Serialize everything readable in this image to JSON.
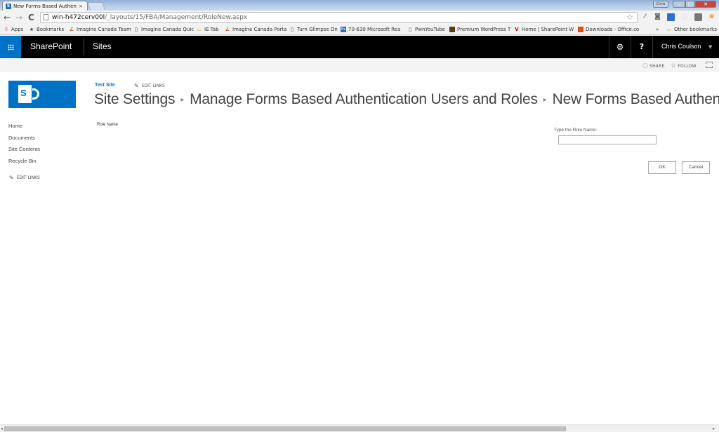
{
  "browser": {
    "tab": {
      "title": "New Forms Based Authen",
      "favicon": "sharepoint-icon",
      "close": "×"
    },
    "window": {
      "user_badge": "Chris",
      "minimize": "–",
      "maximize": "□",
      "close": "✕"
    },
    "toolbar": {
      "back": "←",
      "forward": "→",
      "reload": "C",
      "url_host": "win-h472cerv00l",
      "url_path": "/_layouts/15/FBA/Management/RoleNew.aspx",
      "star": "☆",
      "extensions": [
        "eyedropper-icon",
        "camera-icon",
        "window-icon",
        "refresh-ext-icon",
        "square-ext-icon",
        "menu-icon"
      ],
      "menu": "≡"
    },
    "bookmarks": [
      {
        "label": "Apps",
        "icon": "apps-grid-icon"
      },
      {
        "label": "Bookmarks",
        "icon": "star-icon"
      },
      {
        "label": "Imagine Canada Team",
        "icon": "imagine-canada-icon"
      },
      {
        "label": "Imagine Canada Quic",
        "icon": "page-icon"
      },
      {
        "label": "IE Tab",
        "icon": "folder-icon"
      },
      {
        "label": "Imagine Canada Porta",
        "icon": "imagine-canada-icon"
      },
      {
        "label": "Turn Glimpse On",
        "icon": "page-icon"
      },
      {
        "label": "70-630 Microsoft Rea",
        "icon": "ms-exam-icon"
      },
      {
        "label": "PwnYouTube",
        "icon": "page-icon"
      },
      {
        "label": "Premium WordPress T",
        "icon": "wordpress-theme-icon"
      },
      {
        "label": "Home | SharePoint W",
        "icon": "sharepoint-w-icon"
      },
      {
        "label": "Downloads - Office.co",
        "icon": "office-icon"
      }
    ],
    "bookmarks_overflow": "»",
    "other_bookmarks": "Other bookmarks"
  },
  "suitebar": {
    "brand": "SharePoint",
    "sites": "Sites",
    "settings_icon": "⚙",
    "help": "?",
    "user_name": "Chris Coulson",
    "user_caret": "▼"
  },
  "ribbon": {
    "share": "SHARE",
    "follow": "FOLLOW"
  },
  "header": {
    "site_title": "Test Site",
    "edit_links": "EDIT LINKS",
    "breadcrumb": [
      "Site Settings",
      "Manage Forms Based Authentication Users and Roles",
      "New Forms Based Authentication Role"
    ],
    "breadcrumb_sep": "▸"
  },
  "left_nav": {
    "items": [
      "Home",
      "Documents",
      "Site Contents",
      "Recycle Bin"
    ],
    "edit_links": "EDIT LINKS"
  },
  "form": {
    "section_label": "Role Name",
    "field_label": "Type the Role Name:",
    "field_value": "",
    "ok": "OK",
    "cancel": "Cancel"
  },
  "scrollbar": {
    "left_arrow": "◂",
    "right_arrow": "▸"
  }
}
